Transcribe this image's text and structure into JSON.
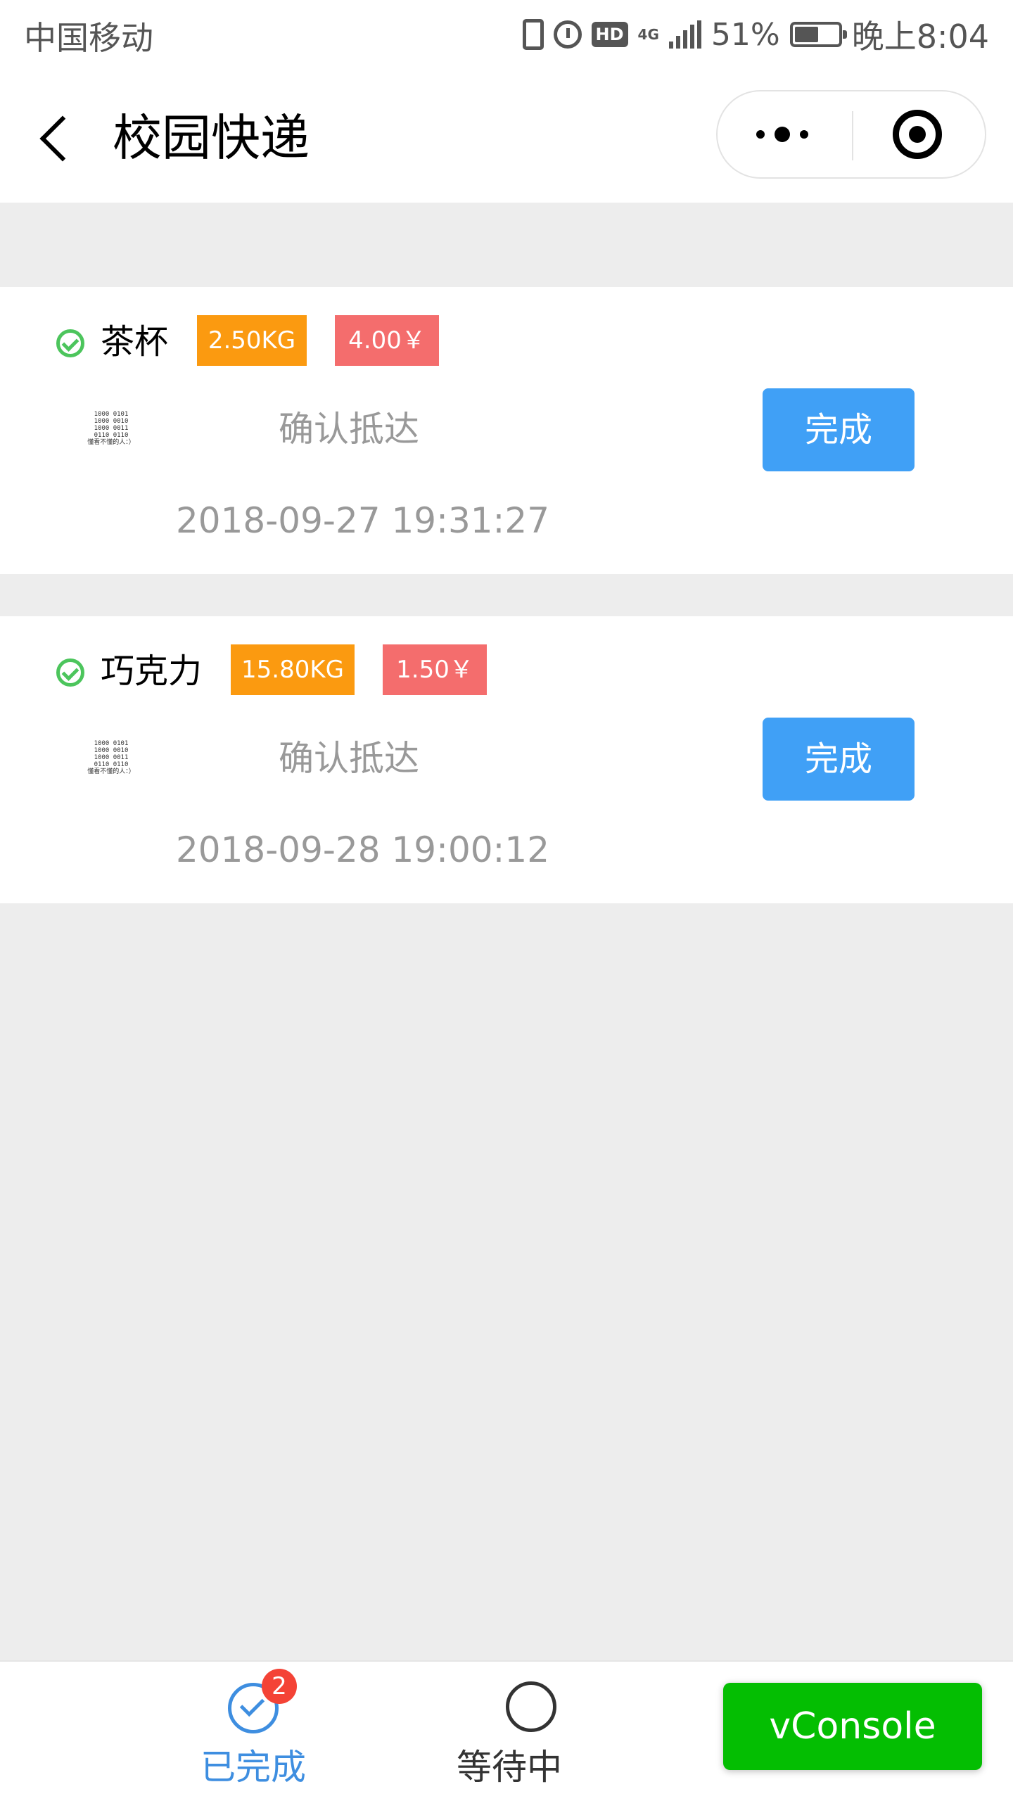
{
  "status_bar": {
    "carrier": "中国移动",
    "network": "4G",
    "battery_percent": "51%",
    "time": "晚上8:04",
    "icons": [
      "vibrate-icon",
      "alarm-icon",
      "hd-icon",
      "signal-icon",
      "battery-icon"
    ],
    "hd_label": "HD"
  },
  "title_bar": {
    "title": "校园快递",
    "icons": [
      "back-chevron-icon",
      "more-dots-icon",
      "close-target-icon"
    ]
  },
  "orders": [
    {
      "name": "茶杯",
      "weight": "2.50KG",
      "price": "4.00￥",
      "status": "确认抵达",
      "button_label": "完成",
      "timestamp": "2018-09-27 19:31:27",
      "thumb_lines": [
        "1000  0101",
        "1000  0010",
        "1000  0011",
        "0110  0110",
        "懂看不懂的人：）"
      ]
    },
    {
      "name": "巧克力",
      "weight": "15.80KG",
      "price": "1.50￥",
      "status": "确认抵达",
      "button_label": "完成",
      "timestamp": "2018-09-28 19:00:12",
      "thumb_lines": [
        "1000  0101",
        "1000  0010",
        "1000  0011",
        "0110  0110",
        "懂看不懂的人：）"
      ]
    }
  ],
  "tab_bar": {
    "tabs": [
      {
        "label": "已完成",
        "badge": "2",
        "active": true,
        "icon": "check-circle-icon"
      },
      {
        "label": "等待中",
        "active": false,
        "icon": "clock-icon"
      }
    ]
  },
  "vconsole": {
    "label": "vConsole"
  },
  "colors": {
    "accent_blue": "#40a0f6",
    "weight_tag": "#fb9a10",
    "price_tag": "#f46d6d",
    "check_green": "#4cc55c",
    "vconsole_green": "#04be02",
    "badge_red": "#f44336"
  }
}
